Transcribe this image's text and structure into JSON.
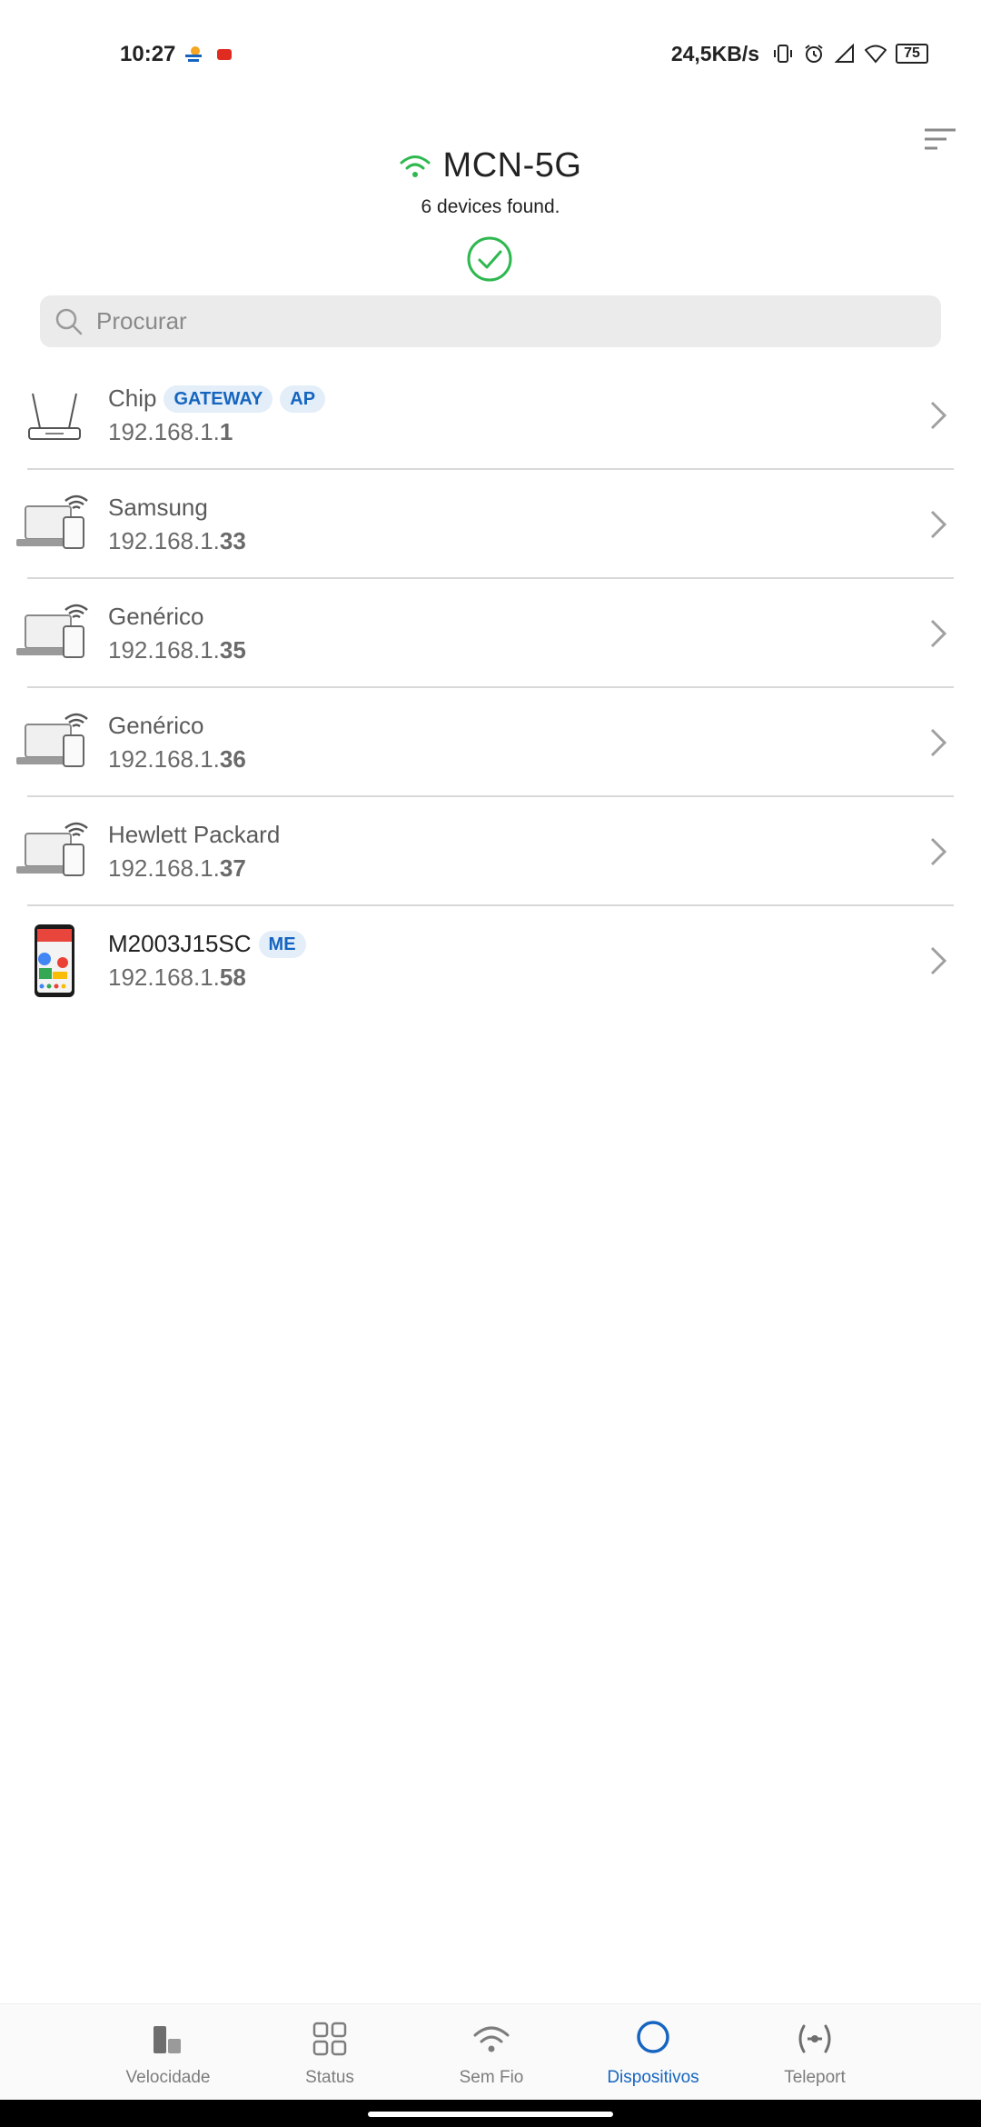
{
  "status_bar": {
    "time": "10:27",
    "net_speed": "24,5KB/s",
    "battery": "75",
    "icons": [
      "weather-icon",
      "youtube-icon",
      "vibrate-icon",
      "alarm-icon",
      "signal-icon",
      "wifi-icon",
      "battery-icon"
    ]
  },
  "header": {
    "network_name": "MCN-5G",
    "devices_found": "6 devices found.",
    "accent_color": "#2eb84f"
  },
  "search": {
    "placeholder": "Procurar"
  },
  "devices": [
    {
      "name": "Chip",
      "ip_prefix": "192.168.1.",
      "ip_suffix": "1",
      "icon": "router-icon",
      "badges": [
        "GATEWAY",
        "AP"
      ]
    },
    {
      "name": "Samsung",
      "ip_prefix": "192.168.1.",
      "ip_suffix": "33",
      "icon": "laptop-wifi-icon",
      "badges": []
    },
    {
      "name": "Genérico",
      "ip_prefix": "192.168.1.",
      "ip_suffix": "35",
      "icon": "laptop-wifi-icon",
      "badges": []
    },
    {
      "name": "Genérico",
      "ip_prefix": "192.168.1.",
      "ip_suffix": "36",
      "icon": "laptop-wifi-icon",
      "badges": []
    },
    {
      "name": "Hewlett Packard",
      "ip_prefix": "192.168.1.",
      "ip_suffix": "37",
      "icon": "laptop-wifi-icon",
      "badges": []
    },
    {
      "name": "M2003J15SC",
      "ip_prefix": "192.168.1.",
      "ip_suffix": "58",
      "icon": "phone-icon",
      "badges": [
        "ME"
      ]
    }
  ],
  "bottom_nav": {
    "items": [
      {
        "label": "Velocidade",
        "icon": "speed-bars-icon",
        "active": false
      },
      {
        "label": "Status",
        "icon": "grid-icon",
        "active": false
      },
      {
        "label": "Sem Fio",
        "icon": "wifi-icon",
        "active": false
      },
      {
        "label": "Dispositivos",
        "icon": "devices-circle-icon",
        "active": true
      },
      {
        "label": "Teleport",
        "icon": "teleport-icon",
        "active": false
      }
    ],
    "active_color": "#1565c0"
  }
}
